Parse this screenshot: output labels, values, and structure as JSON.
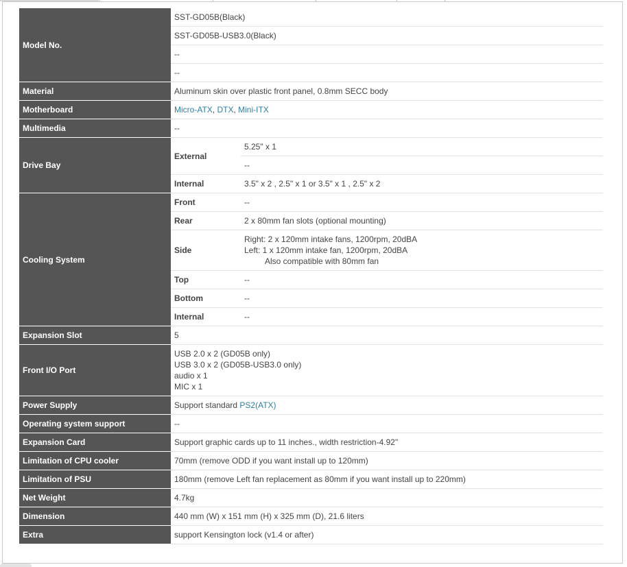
{
  "rows": {
    "model_no": {
      "label": "Model No.",
      "values": [
        "SST-GD05B(Black)",
        "SST-GD05B-USB3.0(Black)",
        "--",
        "--"
      ]
    },
    "material": {
      "label": "Material",
      "value": "Aluminum skin over plastic front panel, 0.8mm SECC body"
    },
    "motherboard": {
      "label": "Motherboard",
      "links": [
        "Micro-ATX",
        "DTX",
        "Mini-ITX"
      ],
      "sep": ", "
    },
    "multimedia": {
      "label": "Multimedia",
      "value": "--"
    },
    "drive_bay": {
      "label": "Drive Bay",
      "external_label": "External",
      "external_values": [
        "5.25\" x 1",
        "--"
      ],
      "internal_label": "Internal",
      "internal_value": "3.5\" x 2 , 2.5\" x 1 or 3.5\" x 1 , 2.5\" x 2"
    },
    "cooling": {
      "label": "Cooling System",
      "front_label": "Front",
      "front_value": "--",
      "rear_label": "Rear",
      "rear_value": "2 x 80mm fan slots (optional mounting)",
      "side_label": "Side",
      "side_lines": [
        "Right: 2 x 120mm intake fans, 1200rpm, 20dBA",
        "Left: 1 x 120mm intake fan, 1200rpm, 20dBA",
        "Also compatible with 80mm fan"
      ],
      "top_label": "Top",
      "top_value": "--",
      "bottom_label": "Bottom",
      "bottom_value": "--",
      "internal_label": "Internal",
      "internal_value": "--"
    },
    "expansion_slot": {
      "label": "Expansion Slot",
      "value": "5"
    },
    "front_io": {
      "label": "Front I/O Port",
      "lines": [
        "USB 2.0 x 2 (GD05B only)",
        "USB 3.0 x 2 (GD05B-USB3.0 only)",
        "audio x 1",
        "MIC x 1"
      ]
    },
    "power_supply": {
      "label": "Power Supply",
      "prefix": "Support standard ",
      "link": "PS2(ATX)"
    },
    "os_support": {
      "label": "Operating system support",
      "value": "--"
    },
    "expansion_card": {
      "label": "Expansion Card",
      "value": "Support graphic cards up to 11 inches., width restriction-4.92\""
    },
    "cpu_cooler": {
      "label": "Limitation of CPU cooler",
      "value": "70mm (remove ODD if you want install up to 120mm)"
    },
    "psu_limit": {
      "label": "Limitation of PSU",
      "value": "180mm (remove Left fan replacement as 80mm if you want install up to 220mm)"
    },
    "net_weight": {
      "label": "Net Weight",
      "value": "4.7kg"
    },
    "dimension": {
      "label": "Dimension",
      "value": "440 mm (W) x 151 mm (H) x 325 mm (D), 21.6 liters"
    },
    "extra": {
      "label": "Extra",
      "value": "support Kensington lock (v1.4 or after)"
    }
  },
  "colors": {
    "header_bg": "#555555",
    "link": "#2f7fa0",
    "text": "#444444"
  }
}
